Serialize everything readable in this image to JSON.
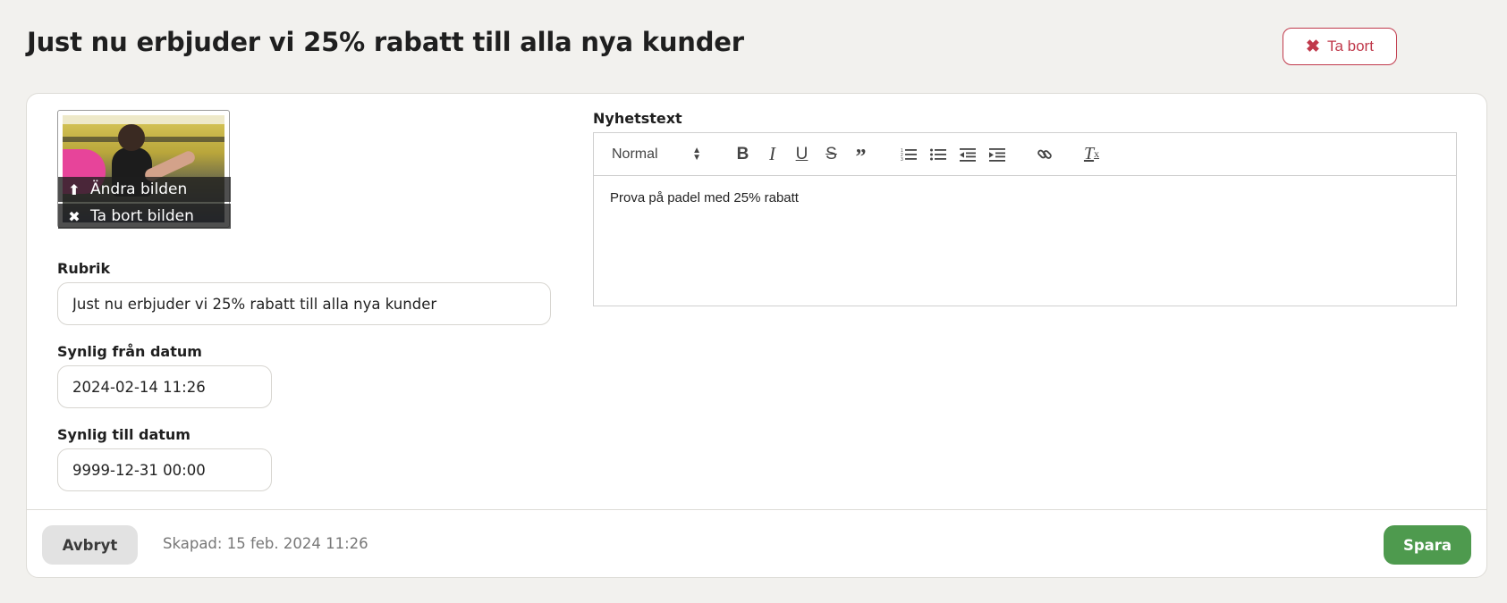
{
  "page": {
    "title": "Just nu erbjuder vi 25% rabatt till alla nya kunder",
    "delete_label": "Ta bort"
  },
  "image": {
    "change_label": "Ändra bilden",
    "remove_label": "Ta bort bilden"
  },
  "form": {
    "rubrik_label": "Rubrik",
    "rubrik_value": "Just nu erbjuder vi 25% rabatt till alla nya kunder",
    "from_label": "Synlig från datum",
    "from_value": "2024-02-14 11:26",
    "to_label": "Synlig till datum",
    "to_value": "9999-12-31 00:00"
  },
  "editor": {
    "label": "Nyhetstext",
    "format_value": "Normal",
    "content": "Prova på padel med 25% rabatt"
  },
  "footer": {
    "cancel_label": "Avbryt",
    "created_text": "Skapad: 15 feb. 2024 11:26",
    "save_label": "Spara"
  },
  "colors": {
    "background": "#f2f1ee",
    "danger": "#c0394b",
    "primary": "#4e9a4e"
  }
}
